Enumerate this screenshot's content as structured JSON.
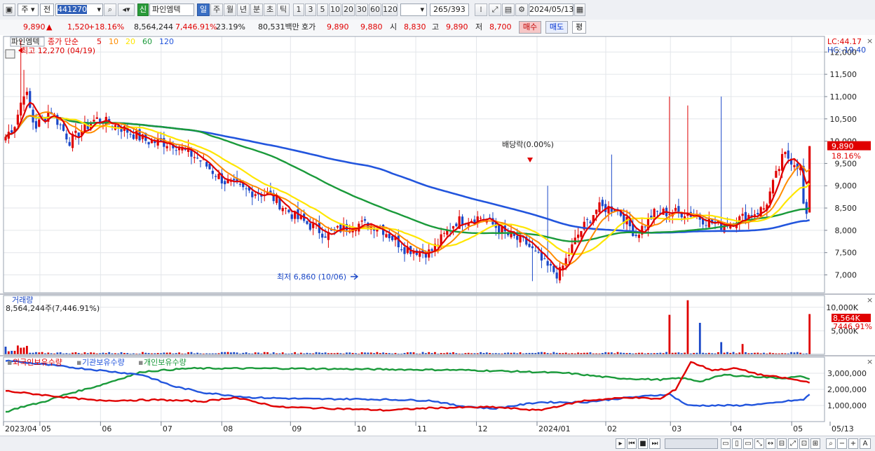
{
  "toolbar": {
    "market": "주",
    "prev": "전",
    "code": "441270",
    "credit_badge": "신",
    "stock_name": "파인엠텍",
    "periods": [
      "일",
      "주",
      "월",
      "년",
      "분",
      "초",
      "틱"
    ],
    "active_period": "일",
    "intervals": [
      "1",
      "3",
      "5",
      "10",
      "20",
      "30",
      "60",
      "120"
    ],
    "count": "265",
    "count_total": "/393",
    "date": "2024/05/13"
  },
  "quote": {
    "price": "9,890",
    "arrow": "▲",
    "change": "1,520",
    "change_pct": "+18.16%",
    "volume": "8,564,244",
    "volume_pct": "7,446.91%",
    "turnover": "23.19%",
    "amount": "80,531백만",
    "hoga_label": "호가",
    "ask": "9,890",
    "bid": "9,880",
    "open_label": "시",
    "open": "8,830",
    "high_label": "고",
    "high": "9,890",
    "low_label": "저",
    "low": "8,700",
    "buy_label": "매수",
    "sell_label": "매도",
    "avg_label": "평"
  },
  "price_panel": {
    "name": "파인엠텍",
    "ma_label": "종가 단순",
    "ma_periods": [
      "5",
      "10",
      "20",
      "60",
      "120"
    ],
    "ma_colors": [
      "#e00000",
      "#ff8c00",
      "#ffe600",
      "#1a9a3a",
      "#2255dd"
    ],
    "high_note": "최고 12,270 (04/19)",
    "low_note": "최저 6,860 (10/06)",
    "dividend_note": "배당락(0.00%)",
    "lc": "LC:44.17",
    "hc": "HC:-19.40",
    "y_ticks": [
      "12,000",
      "11,500",
      "11,000",
      "10,500",
      "10,000",
      "9,500",
      "9,000",
      "8,500",
      "8,000",
      "7,500",
      "7,000"
    ],
    "last_price": "9,890",
    "last_pct": "18.16%"
  },
  "volume_panel": {
    "label": "거래량",
    "value": "8,564,244주(7,446.91%)",
    "y_ticks": [
      "10,000K",
      "5,000K"
    ],
    "last_value": "8,564K",
    "last_pct": "7446.91%"
  },
  "holdings_panel": {
    "series": [
      "외국인보유수량",
      "기관보유수량",
      "개인보유수량"
    ],
    "colors": [
      "#e00000",
      "#2255dd",
      "#1a9a3a"
    ],
    "y_ticks": [
      "3,000,000",
      "2,000,000",
      "1,000,000"
    ]
  },
  "x_axis": {
    "labels": [
      "2023/04",
      "05",
      "06",
      "07",
      "08",
      "09",
      "10",
      "11",
      "12",
      "2024/01",
      "02",
      "03",
      "04",
      "05",
      "05/13"
    ]
  },
  "chart_data": {
    "type": "candlestick",
    "period": "daily",
    "range": [
      "2023/04/19",
      "2024/05/13"
    ],
    "price_ylim": [
      6600,
      12350
    ],
    "price_anchors": [
      {
        "date": "2023/04",
        "close": 10300
      },
      {
        "date": "2023/04/19",
        "close": 10600,
        "high": 12270
      },
      {
        "date": "2023/05",
        "close": 10100
      },
      {
        "date": "2023/06",
        "close": 10100
      },
      {
        "date": "2023/07",
        "close": 9000
      },
      {
        "date": "2023/08",
        "close": 8000
      },
      {
        "date": "2023/09",
        "close": 8200
      },
      {
        "date": "2023/10",
        "close": 7200
      },
      {
        "date": "2023/10/06",
        "low": 6860
      },
      {
        "date": "2023/11",
        "close": 8300
      },
      {
        "date": "2023/12",
        "close": 8100
      },
      {
        "date": "2024/01",
        "close": 8900
      },
      {
        "date": "2024/02",
        "close": 9500
      },
      {
        "date": "2024/03",
        "close": 9400
      },
      {
        "date": "2024/04",
        "close": 8200
      },
      {
        "date": "2024/05",
        "close": 8400
      },
      {
        "date": "2024/05/13",
        "open": 8830,
        "high": 9890,
        "low": 8700,
        "close": 9890
      }
    ],
    "volume_last": 8564244,
    "volume_ylim": [
      0,
      12500000
    ],
    "holdings_ylim": [
      0,
      4000000
    ],
    "holdings_anchors": {
      "외국인보유수량": [
        1800000,
        1400000,
        1200000,
        800000,
        1100000,
        1500000,
        3700000,
        2900000,
        2500000
      ],
      "기관보유수량": [
        3800000,
        3300000,
        2000000,
        1300000,
        900000,
        1200000,
        1000000,
        1100000,
        1500000
      ],
      "개인보유수량": [
        600000,
        1700000,
        3300000,
        3200000,
        3100000,
        3000000,
        2700000,
        2800000,
        2500000
      ]
    }
  }
}
